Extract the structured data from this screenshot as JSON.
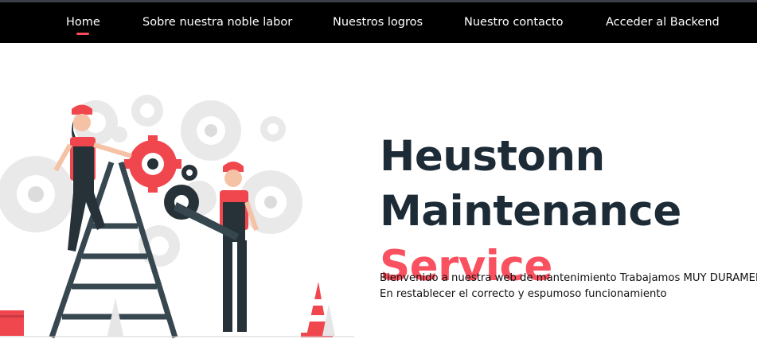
{
  "nav": {
    "items": [
      {
        "label": "Home",
        "active": true
      },
      {
        "label": "Sobre nuestra noble labor",
        "active": false
      },
      {
        "label": "Nuestros logros",
        "active": false
      },
      {
        "label": "Nuestro contacto",
        "active": false
      },
      {
        "label": "Acceder al Backend",
        "active": false
      }
    ],
    "accent_color": "#ff4a5a"
  },
  "hero": {
    "title_line1": "Heustonn",
    "title_line2": "Maintenance",
    "title_line3": "Service",
    "description_line1": "Bienvenido a nuestra web de mantenimiento Trabajamos MUY DURAMENTE",
    "description_line2": "En restablecer el correcto y espumoso funcionamiento",
    "title_color": "#1c2b36",
    "accent_color": "#fa5160",
    "illustration": "maintenance-workers-with-gears-illustration"
  }
}
